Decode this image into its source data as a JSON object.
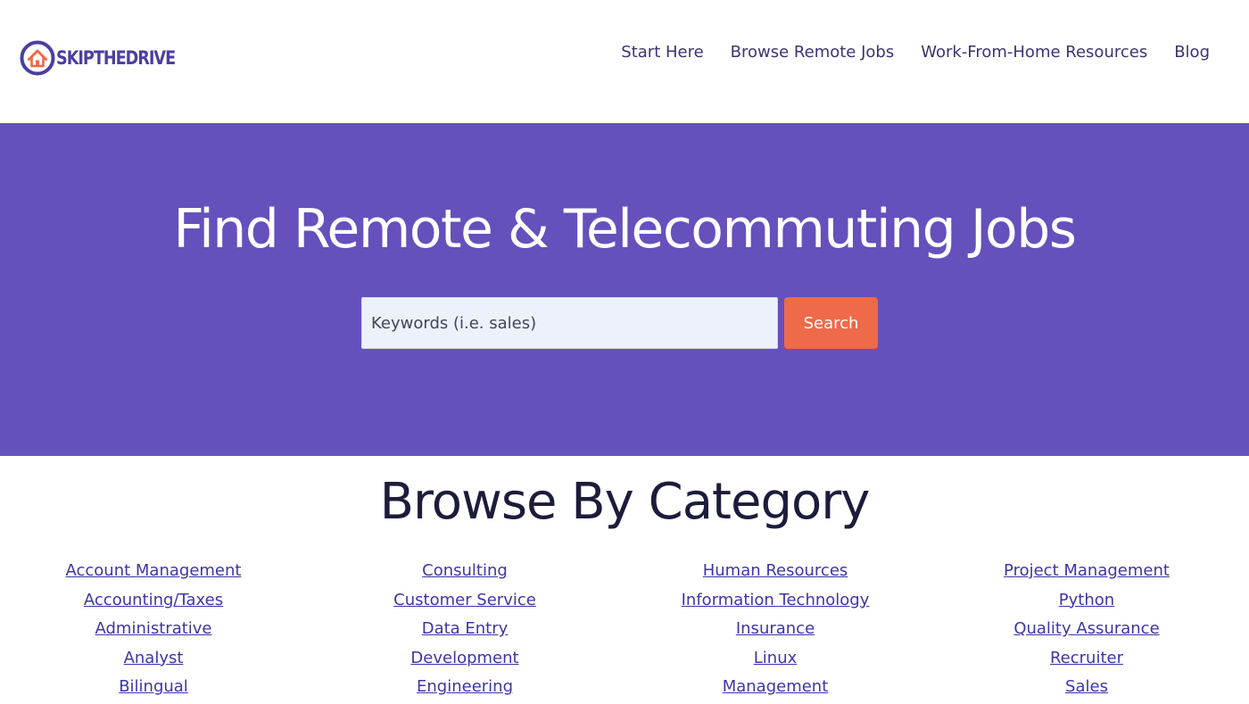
{
  "brand": {
    "logo_text": "SKIPTHEDRIVE"
  },
  "nav": [
    "Start Here",
    "Browse Remote Jobs",
    "Work-From-Home Resources",
    "Blog"
  ],
  "hero": {
    "title": "Find Remote & Telecommuting Jobs",
    "search_placeholder": "Keywords (i.e. sales)",
    "search_value": "",
    "search_button": "Search"
  },
  "categories": {
    "title": "Browse By Category",
    "columns": [
      [
        "Account Management",
        "Accounting/Taxes",
        "Administrative",
        "Analyst",
        "Bilingual"
      ],
      [
        "Consulting",
        "Customer Service",
        "Data Entry",
        "Development",
        "Engineering"
      ],
      [
        "Human Resources",
        "Information Technology",
        "Insurance",
        "Linux",
        "Management"
      ],
      [
        "Project Management",
        "Python",
        "Quality Assurance",
        "Recruiter",
        "Sales"
      ]
    ]
  },
  "colors": {
    "hero_background": "#6650bc",
    "search_button": "#ee6a48",
    "link": "#3d36a6",
    "logo": "#4b3fa0"
  }
}
